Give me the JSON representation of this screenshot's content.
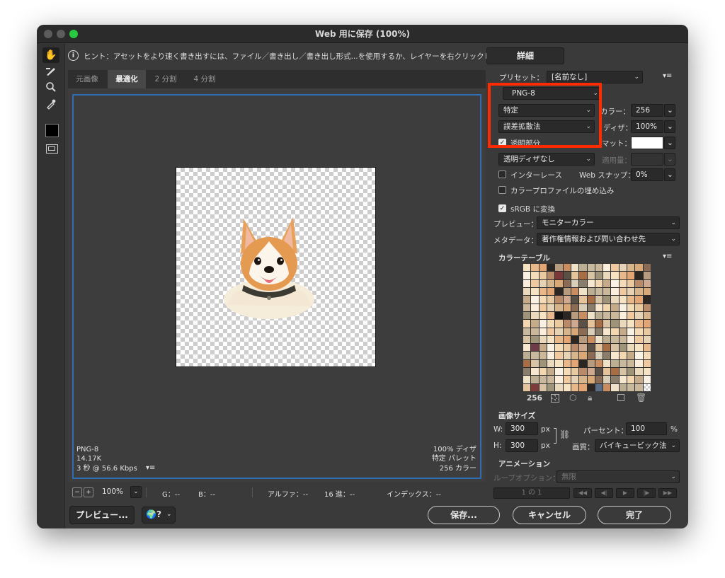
{
  "window": {
    "title": "Web 用に保存 (100%)"
  },
  "hint": {
    "icon": "info-icon",
    "text": "ヒント：アセットをより速く書き出すには、ファイル／書き出し／書き出し形式...を使用するか、レイヤーを右クリックして使用。"
  },
  "detail_button": "詳細",
  "tabs": [
    "元画像",
    "最適化",
    "2 分割",
    "4 分割"
  ],
  "canvas": {
    "info_left": [
      "PNG-8",
      "14.17K",
      "3 秒 @ 56.6 Kbps"
    ],
    "info_right": [
      "100% ディザ",
      "特定 パレット",
      "256 カラー"
    ]
  },
  "statusbar": {
    "zoom": "100%",
    "g": "G：--",
    "b": "B：--",
    "alpha": "アルファ：--",
    "hex": "16 進：--",
    "index": "インデックス：--"
  },
  "bottom": {
    "preview": "プレビュー...",
    "save": "保存...",
    "cancel": "キャンセル",
    "done": "完了"
  },
  "right": {
    "preset_label": "プリセット：",
    "preset_value": "[名前なし]",
    "format": "PNG-8",
    "reduction": "特定",
    "colors_label": "カラー：",
    "colors_value": "256",
    "dither_algo": "誤差拡散法",
    "dither_label": "ディザ：",
    "dither_value": "100%",
    "transparency_label": "透明部分",
    "transparency_checked": true,
    "matte_label": "マット：",
    "trans_dither": "透明ディザなし",
    "amount_label": "適用量：",
    "interlace_label": "インターレース",
    "interlace_checked": false,
    "websnap_label": "Web スナップ：",
    "websnap_value": "0%",
    "embed_profile_label": "カラープロファイルの埋め込み",
    "embed_profile_checked": false,
    "srgb_label": "sRGB に変換",
    "srgb_checked": true,
    "preview_label": "プレビュー：",
    "preview_value": "モニターカラー",
    "metadata_label": "メタデータ：",
    "metadata_value": "著作権情報および問い合わせ先",
    "color_table_label": "カラーテーブル",
    "color_count": "256",
    "image_size_label": "画像サイズ",
    "w_label": "W:",
    "w_value": "300",
    "h_label": "H:",
    "h_value": "300",
    "px": "px",
    "percent_label": "パーセント：",
    "percent_value": "100",
    "percent_unit": "%",
    "quality_label": "画質：",
    "quality_value": "バイキュービック法",
    "animation_label": "アニメーション",
    "loop_label": "ループオプション：",
    "loop_value": "無限",
    "frame_counter": "1 の 1"
  },
  "accent_colors": {
    "selection_frame": "#2f6db5",
    "highlight_box": "#ff2a00",
    "traffic_red": "#5c5c5c",
    "traffic_green": "#28c840"
  }
}
